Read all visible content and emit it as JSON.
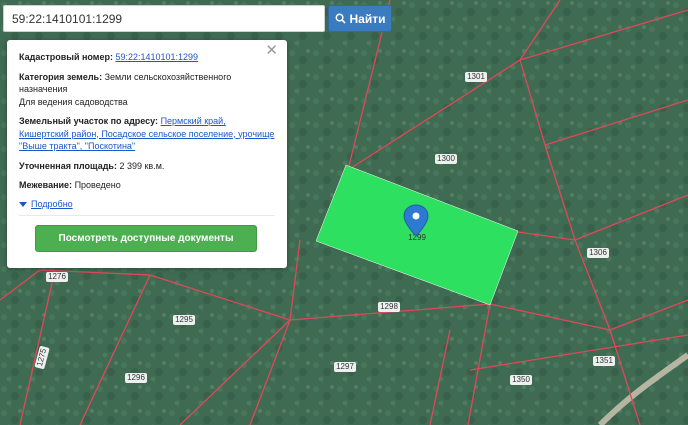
{
  "search": {
    "value": "59:22:1410101:1299",
    "button_label": "Найти"
  },
  "info": {
    "cad_label": "Кадастровый номер:",
    "cad_value": "59:22:1410101:1299",
    "category_label": "Категория земель:",
    "category_value": "Земли сельскохозяйственного назначения",
    "usage": "Для ведения садоводства",
    "address_label": "Земельный участок по адресу:",
    "address_value": "Пермский край, Кишертский район, Посадское сельское поселение, урочище \"Выше тракта\", \"Поскотина\"",
    "area_label": "Уточненная площадь:",
    "area_value": "2 399 кв.м.",
    "survey_label": "Межевание:",
    "survey_value": "Проведено",
    "details_label": "Подробно",
    "docs_button": "Посмотреть доступные документы"
  },
  "map": {
    "selected_color": "#2ee060",
    "boundary_color": "#e0485a",
    "selected_label": "1299",
    "plots": [
      "1301",
      "1300",
      "1306",
      "1298",
      "1276",
      "1295",
      "1275",
      "1296",
      "1297",
      "1350",
      "1351"
    ]
  }
}
